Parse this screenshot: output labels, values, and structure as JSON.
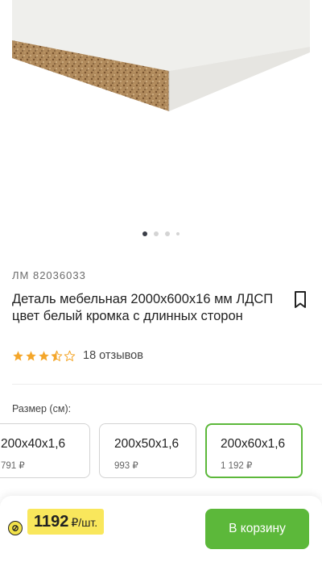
{
  "product": {
    "sku": "ЛМ 82036033",
    "title": "Деталь мебельная 2000x600x16 мм ЛДСП цвет белый кромка с длинных сторон",
    "rating": 3.5,
    "reviews_text": "18 отзывов",
    "image_count": 4,
    "active_image": 1
  },
  "size_section": {
    "label": "Размер (см):",
    "options": [
      {
        "value": "200x40x1,6",
        "price": "791 ₽",
        "selected": false
      },
      {
        "value": "200x50x1,6",
        "price": "993 ₽",
        "selected": false
      },
      {
        "value": "200x60x1,6",
        "price": "1 192 ₽",
        "selected": true
      }
    ]
  },
  "bottom_bar": {
    "price": "1192",
    "unit": "₽/шт.",
    "cart_label": "В корзину"
  },
  "colors": {
    "accent_green": "#5cb83a",
    "price_yellow": "#f9e75c",
    "star_orange": "#f4a62a"
  },
  "icons": {
    "bookmark": "bookmark-icon",
    "star": "star-icon",
    "coin": "coin-icon"
  }
}
